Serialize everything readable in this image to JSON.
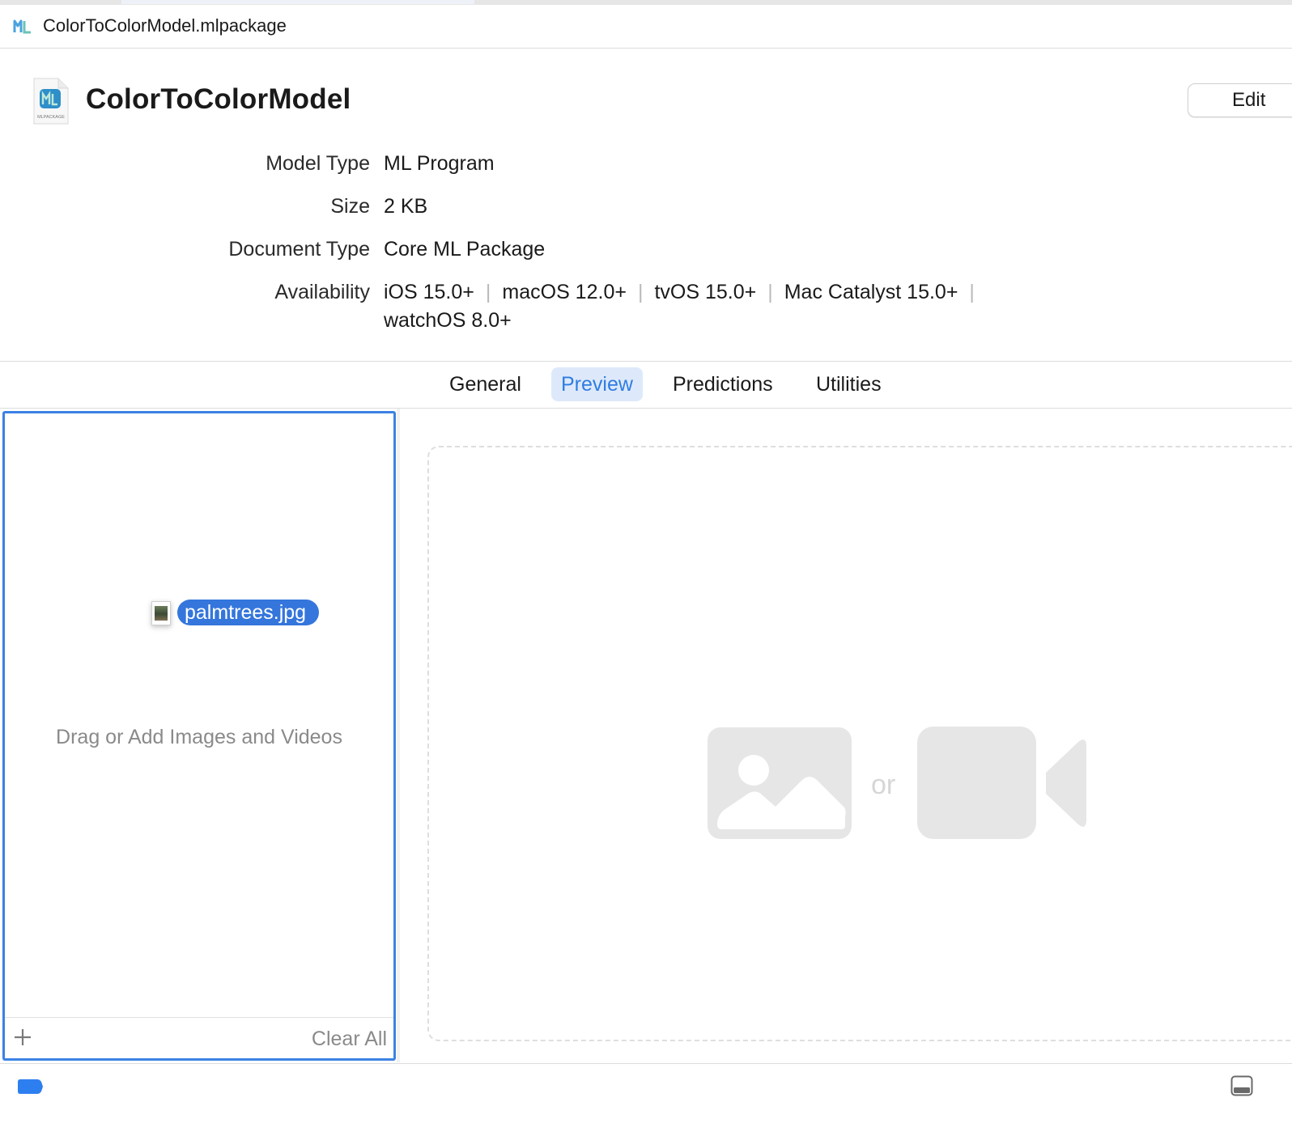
{
  "window": {
    "tab_title": "ColorToColorModel.mlpackage"
  },
  "header": {
    "model_name": "ColorToColorModel",
    "doc_icon_caption": "MLPACKAGE",
    "edit_label": "Edit",
    "properties": [
      {
        "label": "Model Type",
        "value": "ML Program"
      },
      {
        "label": "Size",
        "value": "2 KB"
      },
      {
        "label": "Document Type",
        "value": "Core ML Package"
      }
    ],
    "availability": {
      "label": "Availability",
      "platforms": [
        "iOS 15.0+",
        "macOS 12.0+",
        "tvOS 15.0+",
        "Mac Catalyst 15.0+",
        "watchOS 8.0+"
      ]
    }
  },
  "tabs": [
    {
      "label": "General",
      "active": false
    },
    {
      "label": "Preview",
      "active": true
    },
    {
      "label": "Predictions",
      "active": false
    },
    {
      "label": "Utilities",
      "active": false
    }
  ],
  "left_pane": {
    "drop_hint": "Drag or Add Images and Videos",
    "clear_all_label": "Clear All"
  },
  "drag": {
    "file_name": "palmtrees.jpg"
  },
  "right_pane": {
    "or_text": "or"
  },
  "colors": {
    "accent": "#3b82e4",
    "selection": "#3476dc",
    "tab_active_bg": "#dde9fb",
    "tab_active_text": "#2f7de1",
    "placeholder": "#e6e6e6"
  }
}
